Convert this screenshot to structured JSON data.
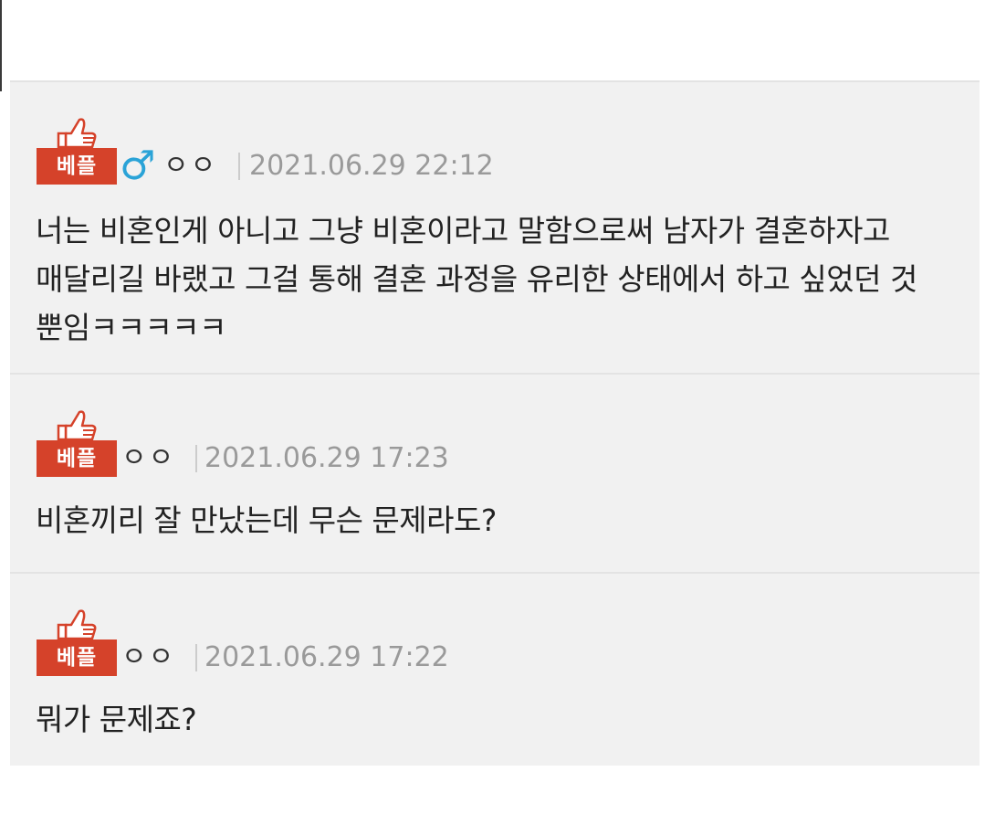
{
  "comments": [
    {
      "badge": "베플",
      "gender_symbol": "♂",
      "nickname": "ㅇㅇ",
      "separator": "|",
      "datetime": "2021.06.29 22:12",
      "lines": [
        "너는 비혼인게 아니고 그냥 비혼이라고 말함으로써 남자가 결혼하자고",
        "매달리길 바랬고 그걸 통해 결혼 과정을 유리한 상태에서 하고 싶었던 것",
        "뿐임ㅋㅋㅋㅋㅋ"
      ]
    },
    {
      "badge": "베플",
      "nickname": "ㅇㅇ",
      "separator": "|",
      "datetime": "2021.06.29 17:23",
      "lines": [
        "비혼끼리 잘 만났는데 무슨 문제라도?"
      ]
    },
    {
      "badge": "베플",
      "nickname": "ㅇㅇ",
      "separator": "|",
      "datetime": "2021.06.29 17:22",
      "lines": [
        "뭐가 문제죠?"
      ]
    }
  ],
  "colors": {
    "badge": "#d5422a",
    "male_symbol": "#2aa3d7",
    "date": "#9a9a9a",
    "panel": "#f1f1f1"
  },
  "icons": {
    "best_comment": "thumbs-up-icon",
    "gender": "male-symbol-icon"
  }
}
